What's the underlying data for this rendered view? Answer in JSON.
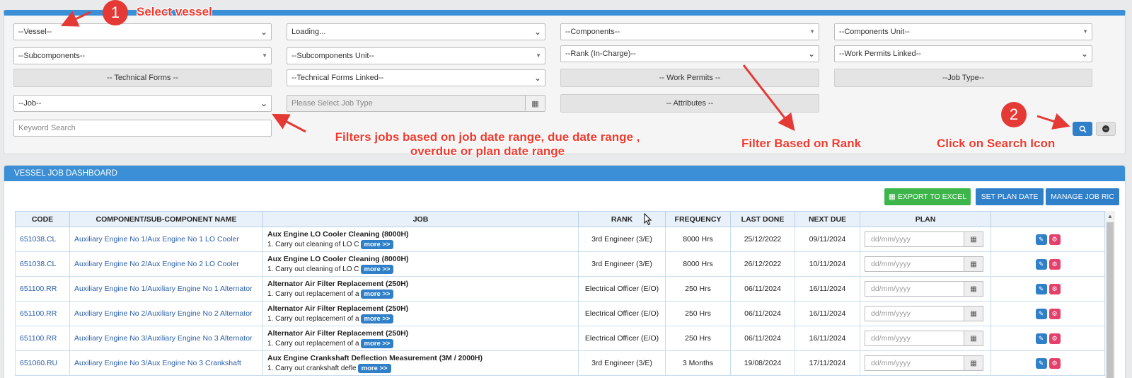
{
  "filters": {
    "vessel": "--Vessel--",
    "loading": "Loading...",
    "components": "--Components--",
    "components_unit": "--Components Unit--",
    "subcomponents": "--Subcomponents--",
    "subcomponents_unit": "--Subcomponents Unit--",
    "rank": "--Rank (In-Charge)--",
    "work_permits_linked": "--Work Permits Linked--",
    "technical_forms": "-- Technical Forms --",
    "technical_forms_linked": "--Technical Forms Linked--",
    "work_permits": "-- Work Permits --",
    "job_type": "--Job Type--",
    "job": "--Job--",
    "job_type_date_placeholder": "Please Select Job Type",
    "attributes": "-- Attributes --",
    "keyword_placeholder": "Keyword Search"
  },
  "annotations": {
    "step1_number": "1",
    "step1_text": "Select vessel",
    "step2_number": "2",
    "step2_text": "Click on Search Icon",
    "filters_text_line1": "Filters jobs based on job date range, due date range ,",
    "filters_text_line2": "overdue or plan date range",
    "rank_text": "Filter Based on Rank"
  },
  "dashboard": {
    "title": "VESSEL JOB DASHBOARD",
    "export_label": "EXPORT TO EXCEL",
    "set_plan_label": "SET PLAN DATE",
    "manage_label": "MANAGE JOB RIC",
    "columns": [
      "CODE",
      "COMPONENT/SUB-COMPONENT NAME",
      "JOB",
      "RANK",
      "FREQUENCY",
      "LAST DONE",
      "NEXT DUE",
      "PLAN"
    ],
    "more_label": "more >>",
    "date_placeholder": "dd/mm/yyyy",
    "rows": [
      {
        "code": "651038.CL",
        "component": "Auxiliary Engine No 1/Aux Engine No 1 LO Cooler",
        "job_title": "Aux Engine LO Cooler Cleaning (8000H)",
        "job_desc": "1. Carry out cleaning of LO C",
        "rank": "3rd Engineer (3/E)",
        "frequency": "8000 Hrs",
        "last_done": "25/12/2022",
        "next_due": "09/11/2024"
      },
      {
        "code": "651038.CL",
        "component": "Auxiliary Engine No 2/Aux Engine No 2 LO Cooler",
        "job_title": "Aux Engine LO Cooler Cleaning (8000H)",
        "job_desc": "1. Carry out cleaning of LO C",
        "rank": "3rd Engineer (3/E)",
        "frequency": "8000 Hrs",
        "last_done": "26/12/2022",
        "next_due": "10/11/2024"
      },
      {
        "code": "651100.RR",
        "component": "Auxiliary Engine No 1/Auxiliary Engine No 1 Alternator",
        "job_title": "Alternator Air Filter Replacement (250H)",
        "job_desc": "1. Carry out replacement of a",
        "rank": "Electrical Officer (E/O)",
        "frequency": "250 Hrs",
        "last_done": "06/11/2024",
        "next_due": "16/11/2024"
      },
      {
        "code": "651100.RR",
        "component": "Auxiliary Engine No 2/Auxiliary Engine No 2 Alternator",
        "job_title": "Alternator Air Filter Replacement (250H)",
        "job_desc": "1. Carry out replacement of a",
        "rank": "Electrical Officer (E/O)",
        "frequency": "250 Hrs",
        "last_done": "06/11/2024",
        "next_due": "16/11/2024"
      },
      {
        "code": "651100.RR",
        "component": "Auxiliary Engine No 3/Auxiliary Engine No 3 Alternator",
        "job_title": "Alternator Air Filter Replacement (250H)",
        "job_desc": "1. Carry out replacement of a",
        "rank": "Electrical Officer (E/O)",
        "frequency": "250 Hrs",
        "last_done": "06/11/2024",
        "next_due": "16/11/2024"
      },
      {
        "code": "651060.RU",
        "component": "Auxiliary Engine No 3/Aux Engine No 3 Crankshaft",
        "job_title": "Aux Engine Crankshaft Deflection Measurement (3M / 2000H)",
        "job_desc": "1. Carry out crankshaft defle",
        "rank": "3rd Engineer (3/E)",
        "frequency": "3 Months",
        "last_done": "19/08/2024",
        "next_due": "17/11/2024"
      }
    ]
  },
  "colors": {
    "header_blue": "#3a8fd6",
    "export_green": "#3db54a",
    "annotation_red": "#e53935"
  },
  "icons": [
    "chevron-down-icon",
    "calendar-icon",
    "search-icon",
    "minus-circle-icon",
    "edit-icon",
    "delete-icon",
    "excel-icon",
    "cursor-icon"
  ]
}
